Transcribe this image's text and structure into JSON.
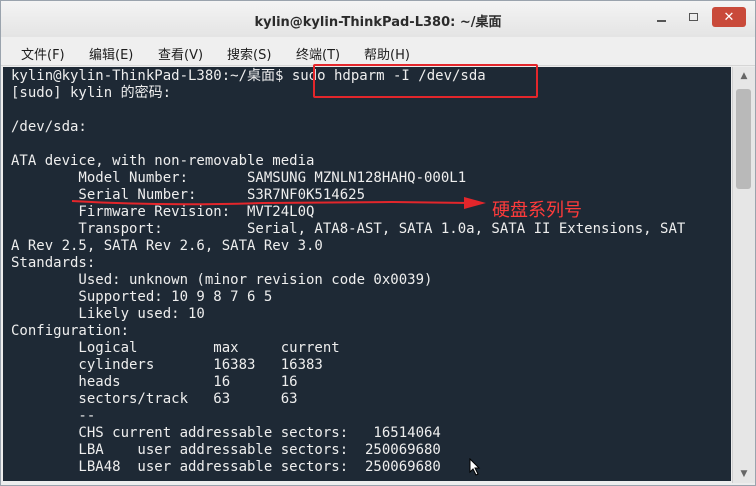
{
  "window": {
    "title": "kylin@kylin-ThinkPad-L380: ~/桌面",
    "minimize_icon": "minimize-icon",
    "maximize_icon": "maximize-icon",
    "close_glyph": "✕"
  },
  "menu": {
    "items": [
      "文件(F)",
      "编辑(E)",
      "查看(V)",
      "搜索(S)",
      "终端(T)",
      "帮助(H)"
    ]
  },
  "terminal": {
    "lines": [
      "kylin@kylin-ThinkPad-L380:~/桌面$ sudo hdparm -I /dev/sda",
      "[sudo] kylin 的密码:",
      "",
      "/dev/sda:",
      "",
      "ATA device, with non-removable media",
      "        Model Number:       SAMSUNG MZNLN128HAHQ-000L1",
      "        Serial Number:      S3R7NF0K514625",
      "        Firmware Revision:  MVT24L0Q",
      "        Transport:          Serial, ATA8-AST, SATA 1.0a, SATA II Extensions, SAT",
      "A Rev 2.5, SATA Rev 2.6, SATA Rev 3.0",
      "Standards:",
      "        Used: unknown (minor revision code 0x0039)",
      "        Supported: 10 9 8 7 6 5",
      "        Likely used: 10",
      "Configuration:",
      "        Logical         max     current",
      "        cylinders       16383   16383",
      "        heads           16      16",
      "        sectors/track   63      63",
      "        --",
      "        CHS current addressable sectors:   16514064",
      "        LBA    user addressable sectors:  250069680",
      "        LBA48  user addressable sectors:  250069680"
    ]
  },
  "annotation": {
    "label": "硬盘系列号",
    "color": "#e3262b"
  },
  "colors": {
    "terminal_bg": "#1e2935",
    "terminal_fg": "#eeeeee",
    "close_button": "#c94a3a"
  }
}
